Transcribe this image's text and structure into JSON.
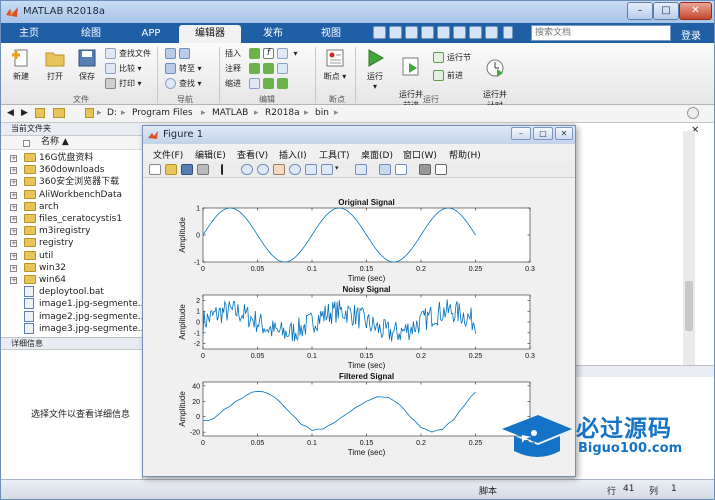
{
  "window": {
    "title": "MATLAB R2018a"
  },
  "tabs": [
    {
      "label": "主页"
    },
    {
      "label": "绘图"
    },
    {
      "label": "APP"
    },
    {
      "label": "编辑器"
    },
    {
      "label": "发布"
    },
    {
      "label": "视图"
    }
  ],
  "search": {
    "placeholder": "搜索文档"
  },
  "login": "登录",
  "ribbon": {
    "file": {
      "new": "新建",
      "open": "打开",
      "save": "保存",
      "find_files": "查找文件",
      "compare": "比较",
      "print": "打印",
      "group": "文件"
    },
    "navigate": {
      "goto": "转至",
      "find": "查找",
      "group": "导航"
    },
    "edit": {
      "insert": "插入",
      "comment": "注释",
      "indent": "缩进",
      "group": "编辑"
    },
    "breakpoints": {
      "breakpoints": "断点",
      "group": "断点"
    },
    "run": {
      "run": "运行",
      "run_advance": "运行并\n前进",
      "run_section": "运行节",
      "advance": "前进",
      "run_time": "运行并\n计时",
      "group": "运行"
    }
  },
  "address": {
    "parts": [
      "D:",
      "Program Files",
      "MATLAB",
      "R2018a",
      "bin"
    ]
  },
  "current_folder": {
    "header": "当前文件夹",
    "col_name": "名称",
    "items": [
      {
        "name": "16G优盘资料",
        "type": "folder"
      },
      {
        "name": "360downloads",
        "type": "folder"
      },
      {
        "name": "360安全浏览器下载",
        "type": "folder"
      },
      {
        "name": "AliWorkbenchData",
        "type": "folder"
      },
      {
        "name": "arch",
        "type": "folder"
      },
      {
        "name": "files_ceratocystis1",
        "type": "folder"
      },
      {
        "name": "m3iregistry",
        "type": "folder"
      },
      {
        "name": "registry",
        "type": "folder"
      },
      {
        "name": "util",
        "type": "folder"
      },
      {
        "name": "win32",
        "type": "folder"
      },
      {
        "name": "win64",
        "type": "folder"
      },
      {
        "name": "deploytool.bat",
        "type": "file"
      },
      {
        "name": "image1.jpg-segmente...",
        "type": "file"
      },
      {
        "name": "image2.jpg-segmente...",
        "type": "file"
      },
      {
        "name": "image3.jpg-segmente...",
        "type": "file"
      }
    ]
  },
  "details": {
    "header": "详细信息",
    "hint": "选择文件以查看详细信息"
  },
  "status": {
    "mode": "脚本",
    "row_label": "行",
    "row": "41",
    "col_label": "列",
    "col": "1"
  },
  "figure": {
    "title": "Figure 1",
    "menu": [
      "文件(F)",
      "编辑(E)",
      "查看(V)",
      "插入(I)",
      "工具(T)",
      "桌面(D)",
      "窗口(W)",
      "帮助(H)"
    ]
  },
  "chart_data": [
    {
      "type": "line",
      "title": "Original Signal",
      "xlabel": "Time (sec)",
      "ylabel": "Amplitude",
      "xlim": [
        0,
        0.3
      ],
      "ylim": [
        -1,
        1
      ],
      "xticks": [
        "0",
        "0.05",
        "0.1",
        "0.15",
        "0.2",
        "0.25",
        "0.3"
      ],
      "yticks": [
        "-1",
        "0",
        "1"
      ],
      "signal": "sine",
      "frequency_hz": 10,
      "amplitude": 1,
      "t_end": 0.25
    },
    {
      "type": "line",
      "title": "Noisy Signal",
      "xlabel": "Time (sec)",
      "ylabel": "Amplitude",
      "xlim": [
        0,
        0.3
      ],
      "ylim": [
        -2.5,
        2.5
      ],
      "xticks": [
        "0",
        "0.05",
        "0.1",
        "0.15",
        "0.2",
        "0.25",
        "0.3"
      ],
      "yticks": [
        "-2",
        "-1",
        "0",
        "1",
        "2"
      ],
      "signal": "noisy sine",
      "frequency_hz": 10,
      "amplitude": 1,
      "noise_amplitude": 1.1,
      "t_end": 0.25
    },
    {
      "type": "line",
      "title": "Filtered Signal",
      "xlabel": "Time (sec)",
      "ylabel": "Amplitude",
      "xlim": [
        0,
        0.3
      ],
      "ylim": [
        -25,
        45
      ],
      "xticks": [
        "0",
        "0.05",
        "0.1",
        "0.15",
        "0.2",
        "0.25",
        "0.3"
      ],
      "yticks": [
        "-20",
        "0",
        "20",
        "40"
      ],
      "x": [
        0,
        0.01,
        0.02,
        0.03,
        0.04,
        0.05,
        0.06,
        0.07,
        0.08,
        0.09,
        0.1,
        0.11,
        0.12,
        0.13,
        0.14,
        0.15,
        0.16,
        0.17,
        0.18,
        0.19,
        0.2,
        0.21,
        0.22,
        0.23,
        0.24,
        0.25
      ],
      "y": [
        -5,
        -2,
        10,
        20,
        28,
        33,
        30,
        20,
        5,
        -10,
        -18,
        -16,
        -8,
        2,
        12,
        20,
        26,
        25,
        16,
        0,
        -14,
        -20,
        -16,
        -4,
        15,
        32
      ]
    }
  ],
  "watermark": {
    "line1": "必过源码",
    "line2": "Biguo100.com"
  }
}
